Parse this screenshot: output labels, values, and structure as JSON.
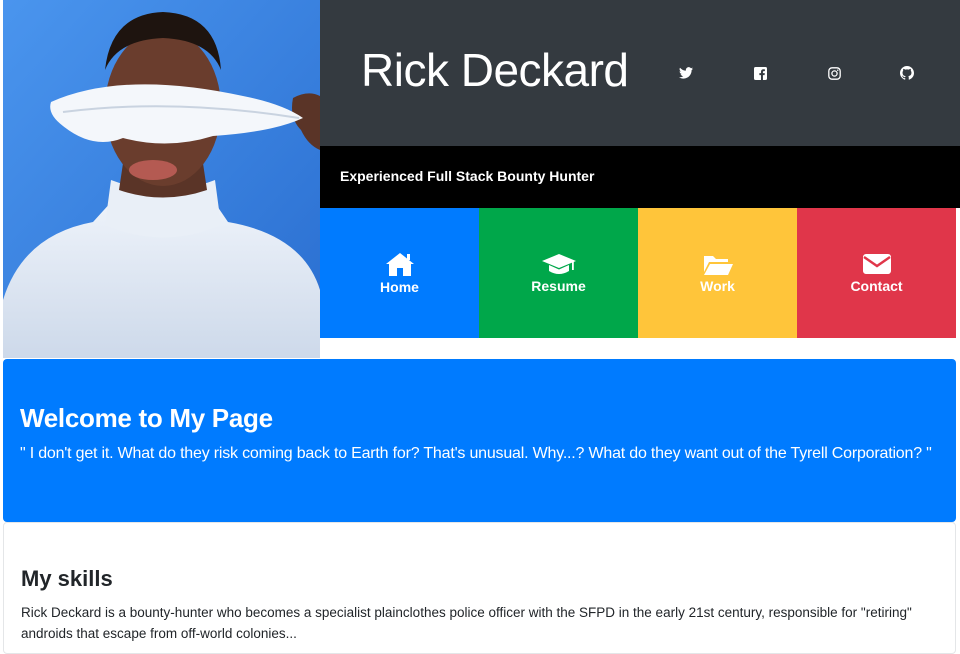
{
  "header": {
    "name": "Rick Deckard",
    "social": [
      {
        "name": "twitter-icon"
      },
      {
        "name": "facebook-icon"
      },
      {
        "name": "instagram-icon"
      },
      {
        "name": "github-icon"
      }
    ]
  },
  "tagline": "Experienced Full Stack Bounty Hunter",
  "nav": [
    {
      "label": "Home",
      "icon": "home-icon",
      "color": "#007bff"
    },
    {
      "label": "Resume",
      "icon": "graduation-cap-icon",
      "color": "#00a74a"
    },
    {
      "label": "Work",
      "icon": "folder-open-icon",
      "color": "#ffc53a"
    },
    {
      "label": "Contact",
      "icon": "envelope-icon",
      "color": "#e0364a"
    }
  ],
  "welcome": {
    "title": "Welcome to My Page",
    "quote": "\" I don't get it. What do they risk coming back to Earth for? That's unusual. Why...? What do they want out of the Tyrell Corporation? \""
  },
  "skills": {
    "title": "My skills",
    "text": "Rick Deckard is a bounty-hunter who becomes a specialist plainclothes police officer with the SFPD in the early 21st century, responsible for \"retiring\" androids that escape from off-world colonies..."
  },
  "colors": {
    "header_bg": "#343a40",
    "tagline_bg": "#000000",
    "jumbotron_bg": "#007bff",
    "photo_bg": "#3484e4"
  }
}
